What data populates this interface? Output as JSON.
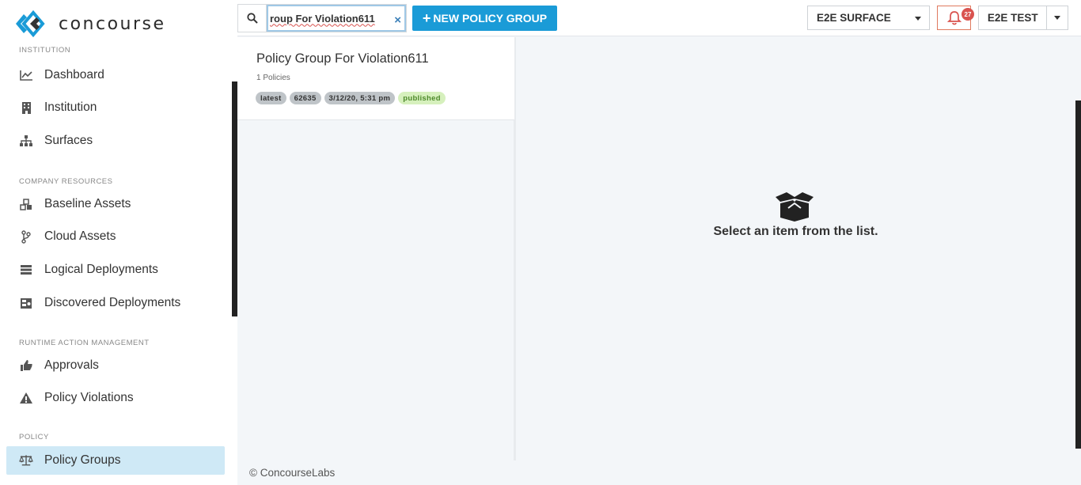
{
  "app": {
    "logo_text": "concourse",
    "brand_color": "#1a9bd7"
  },
  "sidebar": {
    "sections": [
      {
        "title": "INSTITUTION",
        "items": [
          {
            "label": "Dashboard",
            "icon": "chart-line-icon"
          },
          {
            "label": "Institution",
            "icon": "building-icon"
          },
          {
            "label": "Surfaces",
            "icon": "sitemap-icon"
          }
        ]
      },
      {
        "title": "COMPANY RESOURCES",
        "items": [
          {
            "label": "Baseline Assets",
            "icon": "cubes-icon"
          },
          {
            "label": "Cloud Assets",
            "icon": "code-branch-icon"
          },
          {
            "label": "Logical Deployments",
            "icon": "server-icon"
          },
          {
            "label": "Discovered Deployments",
            "icon": "discovered-icon"
          }
        ]
      },
      {
        "title": "RUNTIME ACTION MANAGEMENT",
        "items": [
          {
            "label": "Approvals",
            "icon": "thumbs-up-icon"
          },
          {
            "label": "Policy Violations",
            "icon": "warning-icon"
          }
        ]
      },
      {
        "title": "POLICY",
        "items": [
          {
            "label": "Policy Groups",
            "icon": "balance-scale-icon",
            "active": true
          }
        ]
      }
    ]
  },
  "topbar": {
    "search_value": "roup For Violation611",
    "clear_symbol": "×",
    "new_button_label": "NEW POLICY GROUP",
    "new_button_plus": "+",
    "surface_selected": "E2E SURFACE",
    "notification_count": "27",
    "user_label": "E2E TEST"
  },
  "list": {
    "items": [
      {
        "title": "Policy Group For Violation611",
        "subtitle": "1 Policies",
        "chips": [
          "latest",
          "62635",
          "3/12/20, 5:31 pm",
          "published"
        ]
      }
    ]
  },
  "detail": {
    "empty_message": "Select an item from the list."
  },
  "footer": {
    "copyright": "© ConcourseLabs"
  }
}
